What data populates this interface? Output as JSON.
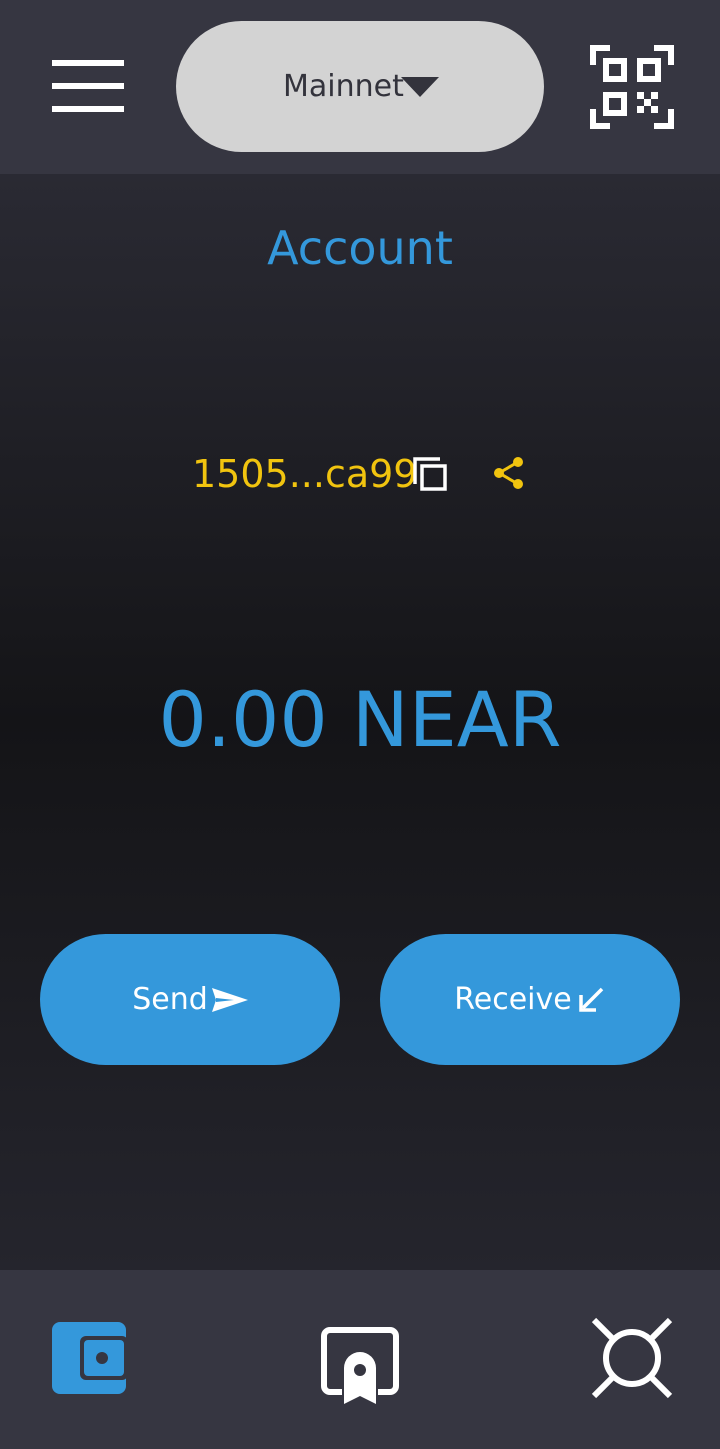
{
  "header": {
    "network": {
      "label": "Mainnet"
    },
    "icons": {
      "menu": "hamburger-menu-icon",
      "network_dropdown": "caret-down-icon",
      "scan": "qr-code-icon"
    }
  },
  "account": {
    "title": "Account",
    "address": "1505...ca99",
    "balance": "0.00 NEAR"
  },
  "actions": {
    "send_label": "Send",
    "receive_label": "Receive"
  },
  "bottom_nav": {
    "items": [
      {
        "icon": "wallet-icon",
        "active": true
      },
      {
        "icon": "nft-badge-icon",
        "active": false
      },
      {
        "icon": "cross-chain-icon",
        "active": false
      }
    ]
  },
  "colors": {
    "accent": "#3498db",
    "address": "#f1c40f",
    "bar_background": "#363641",
    "pill_background": "#d3d3d3",
    "text_on_accent": "#ffffff"
  }
}
